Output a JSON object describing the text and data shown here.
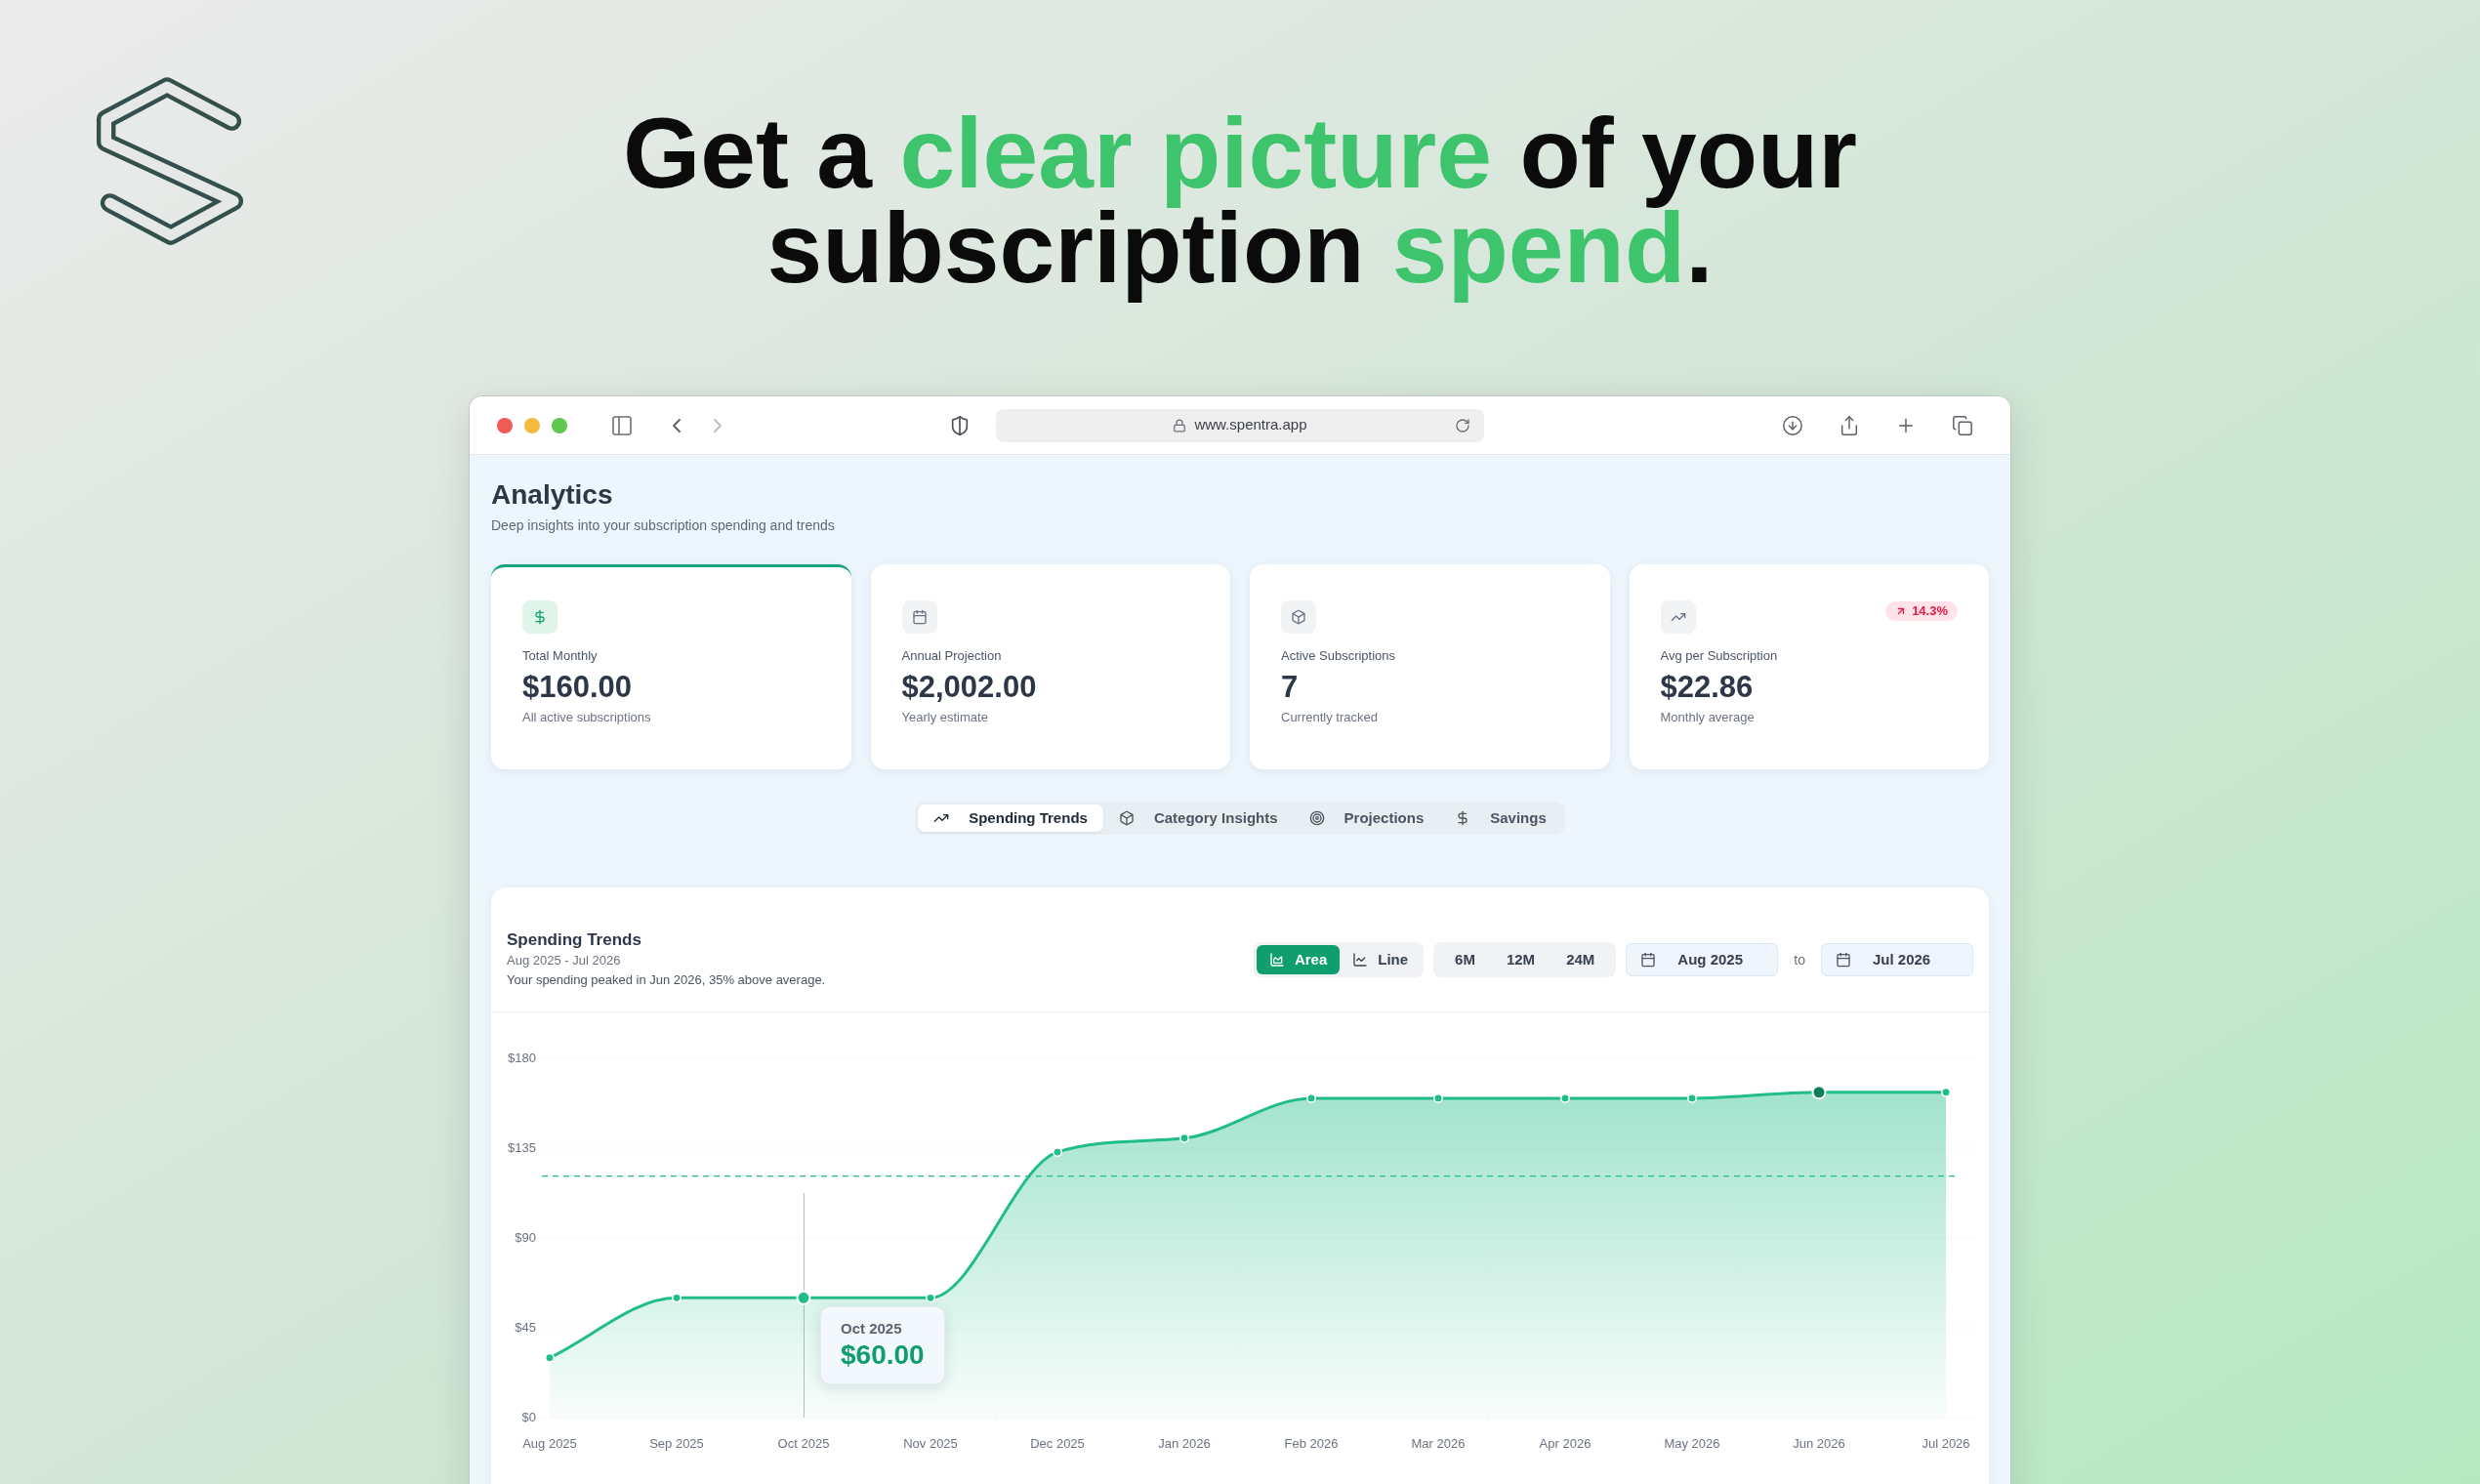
{
  "headline": {
    "lines": [
      [
        {
          "text": "Get a ",
          "accent": false
        },
        {
          "text": "clear picture",
          "accent": true
        },
        {
          "text": " of your",
          "accent": false
        }
      ],
      [
        {
          "text": "subscription ",
          "accent": false
        },
        {
          "text": "spend",
          "accent": true
        },
        {
          "text": ".",
          "accent": false
        }
      ]
    ]
  },
  "browser": {
    "url": "www.spentra.app",
    "back_disabled": false,
    "forward_disabled": true
  },
  "page": {
    "title": "Analytics",
    "subtitle": "Deep insights into your subscription spending and trends"
  },
  "stat_cards": [
    {
      "label": "Total Monthly",
      "value": "$160.00",
      "note": "All active subscriptions",
      "highlighted": true
    },
    {
      "label": "Annual Projection",
      "value": "$2,002.00",
      "note": "Yearly estimate",
      "highlighted": false
    },
    {
      "label": "Active Subscriptions",
      "value": "7",
      "note": "Currently tracked",
      "highlighted": false
    },
    {
      "label": "Avg per Subscription",
      "value": "$22.86",
      "note": "Monthly average",
      "highlighted": false,
      "badge": "14.3%"
    }
  ],
  "tabs": [
    {
      "label": "Spending Trends",
      "selected": true
    },
    {
      "label": "Category Insights",
      "selected": false
    },
    {
      "label": "Projections",
      "selected": false
    },
    {
      "label": "Savings",
      "selected": false
    }
  ],
  "chart_panel": {
    "title": "Spending Trends",
    "period": "Aug 2025 - Jul 2026",
    "summary": "Your spending peaked in Jun 2026, 35% above average.",
    "chart_types": [
      {
        "label": "Area",
        "selected": true
      },
      {
        "label": "Line",
        "selected": false
      }
    ],
    "ranges": [
      {
        "label": "6M",
        "selected": false
      },
      {
        "label": "12M",
        "selected": false
      },
      {
        "label": "24M",
        "selected": false
      }
    ],
    "date_from": "Aug 2025",
    "date_separator": "to",
    "date_to": "Jul 2026",
    "tooltip": {
      "label": "Oct 2025",
      "value": "$60.00"
    },
    "chart_data": {
      "type": "area",
      "categories": [
        "Aug 2025",
        "Sep 2025",
        "Oct 2025",
        "Nov 2025",
        "Dec 2025",
        "Jan 2026",
        "Feb 2026",
        "Mar 2026",
        "Apr 2026",
        "May 2026",
        "Jun 2026",
        "Jul 2026"
      ],
      "values": [
        30,
        60,
        60,
        60,
        133,
        140,
        160,
        160,
        160,
        160,
        163,
        163
      ],
      "color": "#20bd87",
      "ylim": [
        0,
        180
      ],
      "yticks": [
        {
          "value": 0,
          "label": "$0"
        },
        {
          "value": 45,
          "label": "$45"
        },
        {
          "value": 90,
          "label": "$90"
        },
        {
          "value": 135,
          "label": "$135"
        },
        {
          "value": 180,
          "label": "$180"
        }
      ],
      "grid": true,
      "marker": "circle",
      "ref_lines": [
        {
          "axis": "y",
          "value": 121,
          "color": "#20bd87",
          "line_style": "dashed"
        }
      ]
    }
  }
}
